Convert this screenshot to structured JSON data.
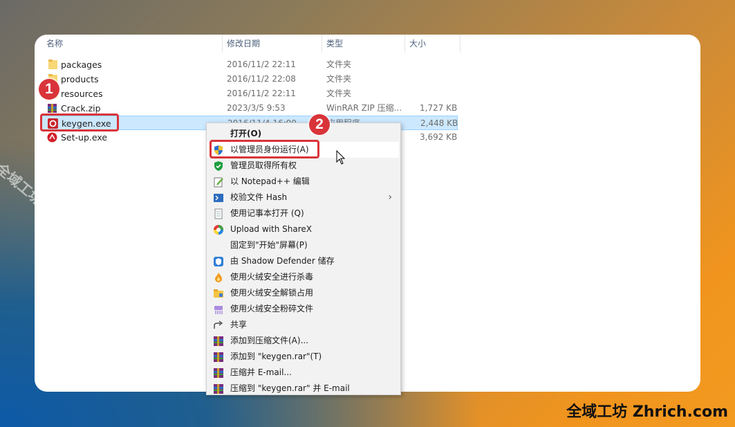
{
  "columns": {
    "name": "名称",
    "modified": "修改日期",
    "type": "类型",
    "size": "大小"
  },
  "files": [
    {
      "name": "packages",
      "modified": "2016/11/2 22:11",
      "type": "文件夹",
      "size": "",
      "icon": "folder-icon"
    },
    {
      "name": "products",
      "modified": "2016/11/2 22:08",
      "type": "文件夹",
      "size": "",
      "icon": "folder-icon"
    },
    {
      "name": "resources",
      "modified": "2016/11/2 22:11",
      "type": "文件夹",
      "size": "",
      "icon": "folder-icon"
    },
    {
      "name": "Crack.zip",
      "modified": "2023/3/5 9:53",
      "type": "WinRAR ZIP 压缩...",
      "size": "1,727 KB",
      "icon": "winrar-icon"
    },
    {
      "name": "keygen.exe",
      "modified": "2016/11/4 16:00",
      "type": "应用程序",
      "size": "2,448 KB",
      "icon": "keygen-icon",
      "selected": true
    },
    {
      "name": "Set-up.exe",
      "modified": "",
      "type": "",
      "size": "3,692 KB",
      "icon": "adobe-setup-icon"
    }
  ],
  "context_menu": {
    "items": [
      {
        "label": "打开(O)",
        "icon": ""
      },
      {
        "label": "以管理员身份运行(A)",
        "icon": "uac-shield-icon"
      },
      {
        "label": "管理员取得所有权",
        "icon": "green-shield-icon"
      },
      {
        "label": "以 Notepad++ 编辑",
        "icon": "notepadpp-icon"
      },
      {
        "label": "校验文件 Hash",
        "icon": "powershell-icon",
        "submenu": true
      },
      {
        "label": "使用记事本打开 (Q)",
        "icon": "notepad-icon"
      },
      {
        "label": "Upload with ShareX",
        "icon": "sharex-icon"
      },
      {
        "label": "固定到\"开始\"屏幕(P)",
        "icon": ""
      },
      {
        "label": "由 Shadow Defender 储存",
        "icon": "shadow-defender-icon"
      },
      {
        "label": "使用火绒安全进行杀毒",
        "icon": "huorong-icon"
      },
      {
        "label": "使用火绒安全解锁占用",
        "icon": "unlock-folder-icon"
      },
      {
        "label": "使用火绒安全粉碎文件",
        "icon": "shredder-icon"
      },
      {
        "label": "共享",
        "icon": "share-icon"
      },
      {
        "label": "添加到压缩文件(A)...",
        "icon": "winrar-icon"
      },
      {
        "label": "添加到 \"keygen.rar\"(T)",
        "icon": "winrar-icon"
      },
      {
        "label": "压缩并 E-mail...",
        "icon": "winrar-icon"
      },
      {
        "label": "压缩到 \"keygen.rar\" 并 E-mail",
        "icon": "winrar-icon"
      }
    ]
  },
  "annotations": {
    "step1": "1",
    "step2": "2"
  },
  "watermark": "全域工坊 zhrich.com",
  "brand": "全域工坊 Zhrich.com",
  "colors": {
    "highlight": "#d9343a",
    "selection": "#cce8ff",
    "menu_bg": "#f2f2f2"
  }
}
